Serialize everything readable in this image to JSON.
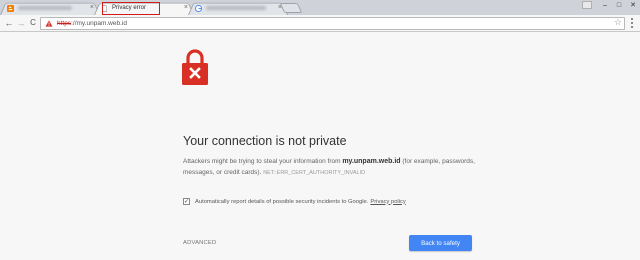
{
  "tabs": [
    {
      "label": "",
      "favicon": "blogger-icon",
      "active": false
    },
    {
      "label": "Privacy error",
      "favicon": "page-icon",
      "active": true
    },
    {
      "label": "",
      "favicon": "google-icon",
      "active": false
    },
    {
      "label": "",
      "favicon": "",
      "active": false
    }
  ],
  "window_controls": {
    "minimize": "–",
    "maximize": "□",
    "close": "✕"
  },
  "toolbar": {
    "back_icon": "←",
    "forward_icon": "→",
    "reload_icon": "C",
    "url_scheme": "https",
    "url_rest": "://my.unpam.web.id",
    "star_icon": "☆"
  },
  "page": {
    "heading": "Your connection is not private",
    "desc_before": "Attackers might be trying to steal your information from ",
    "desc_host": "my.unpam.web.id",
    "desc_after": " (for example, passwords, messages, or credit cards).",
    "error_code": "NET::ERR_CERT_AUTHORITY_INVALID",
    "report_label": "Automatically report details of possible security incidents to Google.",
    "report_checked": true,
    "policy_link": "Privacy policy",
    "advanced_label": "ADVANCED",
    "back_button": "Back to safety"
  },
  "colors": {
    "accent_blue": "#4285f4",
    "lock_red": "#d93025",
    "highlight_red": "#d31a1a"
  }
}
